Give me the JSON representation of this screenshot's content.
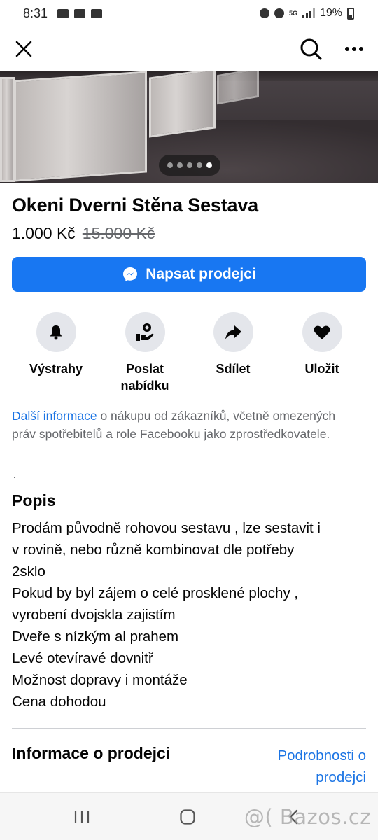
{
  "status_bar": {
    "time": "8:31",
    "network": "5G",
    "battery": "19%"
  },
  "header": {
    "close_icon": "close-icon",
    "search_icon": "search-icon",
    "more_icon": "more-horizontal-icon"
  },
  "carousel": {
    "image_count": 5,
    "active_index": 4
  },
  "listing": {
    "title": "Okeni Dverni Stěna Sestava",
    "price": "1.000 Kč",
    "old_price": "15.000 Kč"
  },
  "message_button": {
    "label": "Napsat prodejci",
    "icon": "messenger-icon"
  },
  "actions": [
    {
      "label": "Výstrahy",
      "icon": "bell-icon"
    },
    {
      "label": "Poslat nabídku",
      "icon": "offer-icon"
    },
    {
      "label": "Sdílet",
      "icon": "share-icon"
    },
    {
      "label": "Uložit",
      "icon": "heart-icon"
    }
  ],
  "legal": {
    "link_text": "Další informace",
    "rest": " o nákupu od zákazníků, včetně omezených práv spotřebitelů a role Facebooku jako zprostředkovatele."
  },
  "description": {
    "heading": "Popis",
    "lines": [
      "Prodám původně rohovou sestavu , lze sestavit i",
      "v rovině, nebo různě kombinovat dle potřeby",
      "2sklo",
      "Pokud by byl zájem o celé prosklené plochy ,",
      "vyrobení dvojskla zajistím",
      "Dveře s nízkým al prahem",
      "Levé otevíravé dovnitř",
      "Možnost dopravy i montáže",
      "Cena dohodou"
    ]
  },
  "seller_info": {
    "heading": "Informace o prodejci",
    "details_link": "Podrobnosti o prodejci"
  },
  "watermark": "@( Bazos.cz"
}
